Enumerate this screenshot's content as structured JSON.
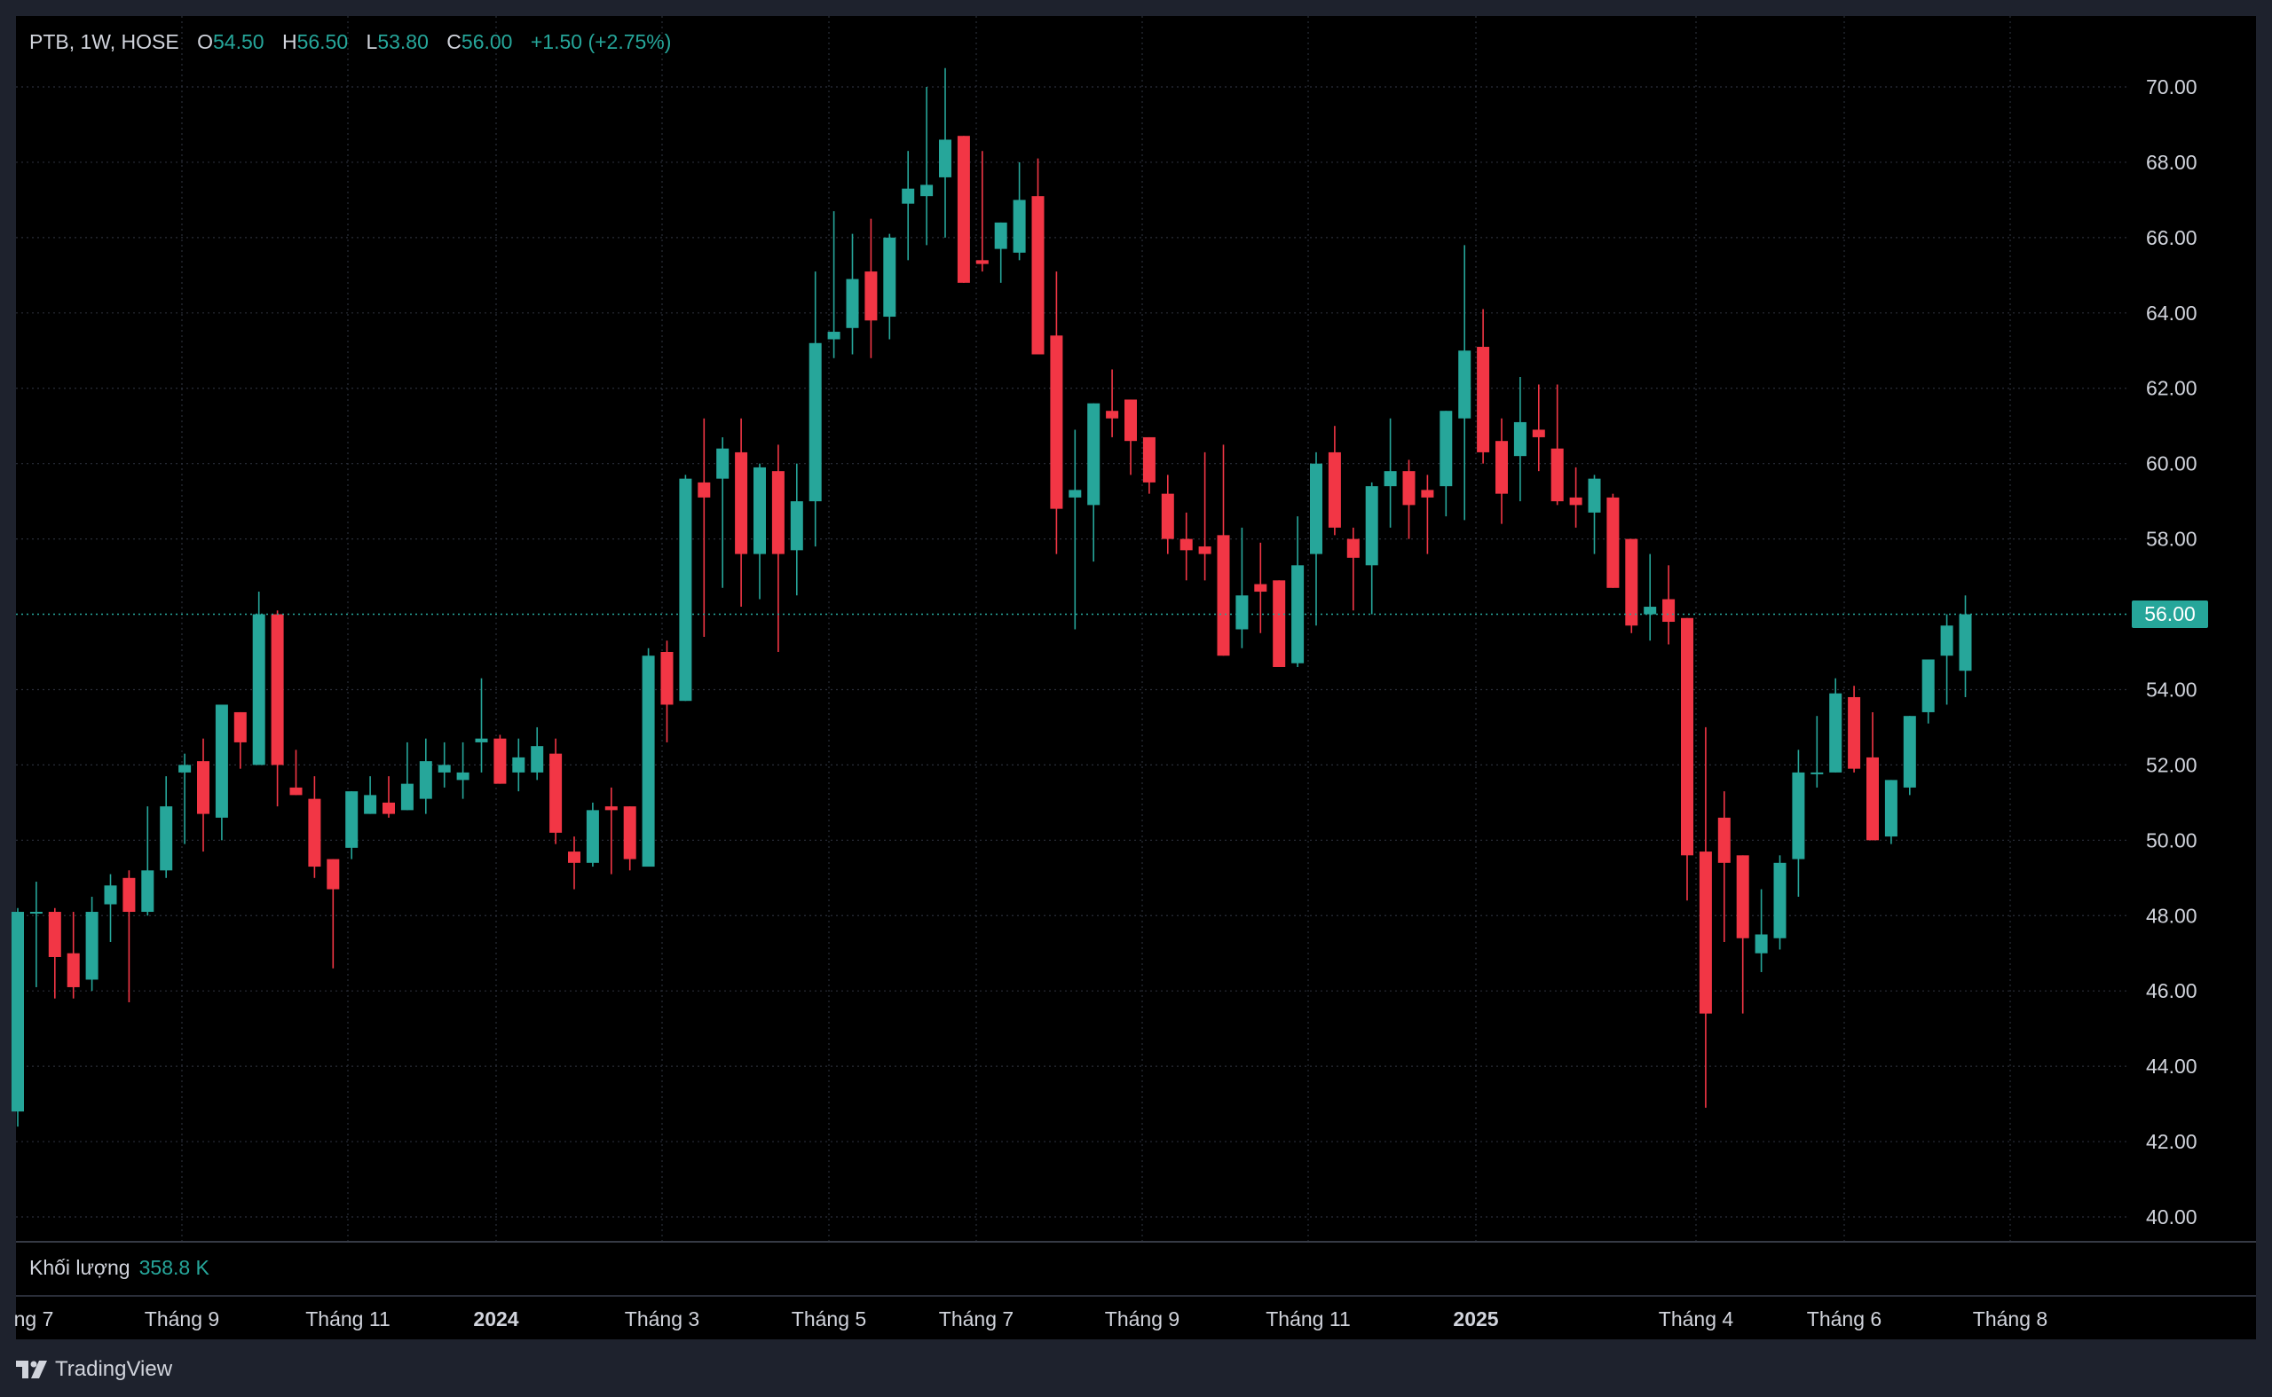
{
  "legend": {
    "symbol": "PTB, 1W, HOSE",
    "o_label": "O",
    "o": "54.50",
    "h_label": "H",
    "h": "56.50",
    "l_label": "L",
    "l": "53.80",
    "c_label": "C",
    "c": "56.00",
    "change": "+1.50 (+2.75%)"
  },
  "volume": {
    "label": "Khối lượng",
    "value": "358.8 K"
  },
  "last_price": "56.00",
  "brand": "TradingView",
  "colors": {
    "up": "#26a69a",
    "down": "#f23645",
    "grid": "#2a2e39",
    "text": "#d1d4dc",
    "bg": "#000000",
    "axis_bg": "#1e222d"
  },
  "chart_data": {
    "type": "candlestick",
    "interval": "1W",
    "y_ticks": [
      "40.00",
      "42.00",
      "44.00",
      "46.00",
      "48.00",
      "50.00",
      "52.00",
      "54.00",
      "56.00",
      "58.00",
      "60.00",
      "62.00",
      "64.00",
      "66.00",
      "68.00",
      "70.00"
    ],
    "ylim": [
      39.3,
      71.4
    ],
    "x_labels": [
      "ng 7",
      "Tháng 9",
      "Tháng 11",
      "2024",
      "Tháng 3",
      "Tháng 5",
      "Tháng 7",
      "Tháng 9",
      "Tháng 11",
      "2025",
      "Tháng 4",
      "Tháng 6",
      "Tháng 8"
    ],
    "x_bold": [
      false,
      false,
      false,
      true,
      false,
      false,
      false,
      false,
      false,
      true,
      false,
      false,
      false
    ],
    "candles": [
      [
        42.8,
        48.2,
        42.4,
        48.1
      ],
      [
        48.1,
        48.9,
        46.1,
        48.1
      ],
      [
        48.1,
        48.2,
        45.8,
        46.9
      ],
      [
        47.0,
        48.1,
        45.8,
        46.1
      ],
      [
        46.3,
        48.5,
        46.0,
        48.1
      ],
      [
        48.3,
        49.1,
        47.3,
        48.8
      ],
      [
        49.0,
        49.2,
        45.7,
        48.1
      ],
      [
        48.1,
        50.9,
        48.0,
        49.2
      ],
      [
        49.2,
        51.7,
        49.0,
        50.9
      ],
      [
        51.8,
        52.3,
        49.9,
        52.0
      ],
      [
        52.1,
        52.7,
        49.7,
        50.7
      ],
      [
        50.6,
        52.6,
        50.0,
        53.6
      ],
      [
        53.4,
        53.3,
        51.9,
        52.6
      ],
      [
        52.0,
        56.6,
        52.2,
        56.0
      ],
      [
        56.0,
        56.1,
        50.9,
        52.0
      ],
      [
        51.4,
        52.4,
        51.3,
        51.2
      ],
      [
        51.1,
        51.7,
        49.0,
        49.3
      ],
      [
        49.5,
        49.5,
        46.6,
        48.7
      ],
      [
        49.8,
        51.3,
        49.5,
        51.3
      ],
      [
        50.7,
        51.7,
        50.8,
        51.2
      ],
      [
        51.0,
        51.7,
        50.6,
        50.7
      ],
      [
        50.8,
        52.6,
        50.8,
        51.5
      ],
      [
        51.1,
        52.7,
        50.7,
        52.1
      ],
      [
        51.8,
        52.6,
        51.4,
        52.0
      ],
      [
        51.6,
        52.6,
        51.1,
        51.8
      ],
      [
        52.6,
        54.3,
        51.8,
        52.7
      ],
      [
        52.7,
        52.8,
        51.5,
        51.5
      ],
      [
        51.8,
        52.7,
        51.3,
        52.2
      ],
      [
        51.8,
        53.0,
        51.6,
        52.5
      ],
      [
        52.3,
        52.7,
        49.9,
        50.2
      ],
      [
        49.7,
        50.1,
        48.7,
        49.4
      ],
      [
        49.4,
        51.0,
        49.3,
        50.8
      ],
      [
        50.9,
        51.4,
        49.1,
        50.8
      ],
      [
        50.9,
        50.9,
        49.2,
        49.5
      ],
      [
        49.3,
        55.1,
        49.3,
        54.9
      ],
      [
        55.0,
        55.3,
        52.6,
        53.6
      ],
      [
        53.7,
        59.7,
        54.2,
        59.6
      ],
      [
        59.5,
        61.2,
        55.4,
        59.1
      ],
      [
        59.6,
        60.7,
        56.7,
        60.4
      ],
      [
        60.3,
        61.2,
        56.2,
        57.6
      ],
      [
        57.6,
        60.0,
        56.4,
        59.9
      ],
      [
        59.8,
        60.5,
        55.0,
        57.6
      ],
      [
        57.7,
        60.0,
        56.5,
        59.0
      ],
      [
        59.0,
        65.1,
        57.8,
        63.2
      ],
      [
        63.3,
        66.7,
        62.8,
        63.5
      ],
      [
        63.6,
        66.1,
        62.9,
        64.9
      ],
      [
        65.1,
        66.5,
        62.8,
        63.8
      ],
      [
        63.9,
        66.1,
        63.3,
        66.0
      ],
      [
        66.9,
        68.3,
        65.4,
        67.3
      ],
      [
        67.1,
        70.0,
        65.8,
        67.4
      ],
      [
        67.6,
        70.5,
        66.0,
        68.6
      ],
      [
        68.7,
        68.2,
        65.1,
        64.8
      ],
      [
        65.4,
        68.3,
        65.1,
        65.3
      ],
      [
        65.7,
        66.2,
        64.8,
        66.4
      ],
      [
        65.6,
        68.0,
        65.4,
        67.0
      ],
      [
        67.1,
        68.1,
        63.5,
        62.9
      ],
      [
        63.4,
        65.1,
        57.6,
        58.8
      ],
      [
        59.1,
        60.9,
        55.6,
        59.3
      ],
      [
        58.9,
        61.4,
        57.4,
        61.6
      ],
      [
        61.4,
        62.5,
        60.7,
        61.2
      ],
      [
        61.7,
        61.3,
        59.7,
        60.6
      ],
      [
        60.7,
        60.4,
        59.2,
        59.5
      ],
      [
        59.2,
        59.7,
        57.6,
        58.0
      ],
      [
        58.0,
        58.7,
        56.9,
        57.7
      ],
      [
        57.8,
        60.3,
        56.9,
        57.6
      ],
      [
        58.1,
        60.5,
        54.9,
        54.9
      ],
      [
        55.6,
        58.3,
        55.1,
        56.5
      ],
      [
        56.8,
        57.9,
        55.5,
        56.6
      ],
      [
        56.9,
        56.7,
        54.9,
        54.6
      ],
      [
        54.7,
        58.6,
        54.6,
        57.3
      ],
      [
        57.6,
        60.3,
        55.7,
        60.0
      ],
      [
        60.3,
        61.0,
        58.1,
        58.3
      ],
      [
        58.0,
        58.3,
        56.1,
        57.5
      ],
      [
        57.3,
        59.5,
        56.0,
        59.4
      ],
      [
        59.4,
        61.2,
        58.3,
        59.8
      ],
      [
        59.8,
        60.1,
        58.0,
        58.9
      ],
      [
        59.3,
        59.7,
        57.6,
        59.1
      ],
      [
        59.4,
        60.4,
        58.6,
        61.4
      ],
      [
        61.2,
        65.8,
        58.5,
        63.0
      ],
      [
        63.1,
        64.1,
        60.0,
        60.3
      ],
      [
        60.6,
        61.2,
        58.4,
        59.2
      ],
      [
        60.2,
        62.3,
        59.0,
        61.1
      ],
      [
        60.9,
        62.1,
        59.8,
        60.7
      ],
      [
        60.4,
        62.1,
        58.9,
        59.0
      ],
      [
        59.1,
        59.9,
        58.3,
        58.9
      ],
      [
        58.7,
        59.7,
        57.6,
        59.6
      ],
      [
        59.1,
        59.2,
        56.9,
        56.7
      ],
      [
        58.0,
        57.8,
        55.5,
        55.7
      ],
      [
        56.0,
        57.6,
        55.3,
        56.2
      ],
      [
        56.4,
        57.3,
        55.2,
        55.8
      ],
      [
        55.9,
        55.8,
        48.4,
        49.6
      ],
      [
        49.7,
        53.0,
        42.9,
        45.4
      ],
      [
        50.6,
        51.3,
        47.3,
        49.4
      ],
      [
        49.6,
        48.5,
        45.4,
        47.4
      ],
      [
        47.0,
        48.7,
        46.5,
        47.5
      ],
      [
        47.4,
        49.6,
        47.1,
        49.4
      ],
      [
        49.5,
        52.4,
        48.5,
        51.8
      ],
      [
        51.8,
        53.3,
        51.4,
        51.8
      ],
      [
        51.8,
        54.3,
        52.3,
        53.9
      ],
      [
        53.8,
        54.1,
        51.8,
        51.9
      ],
      [
        52.2,
        53.4,
        50.1,
        50.0
      ],
      [
        50.1,
        51.5,
        49.9,
        51.6
      ],
      [
        51.4,
        52.9,
        51.2,
        53.3
      ],
      [
        53.4,
        54.1,
        53.1,
        54.8
      ],
      [
        54.9,
        56.0,
        53.6,
        55.7
      ],
      [
        54.5,
        56.5,
        53.8,
        56.0
      ]
    ]
  }
}
